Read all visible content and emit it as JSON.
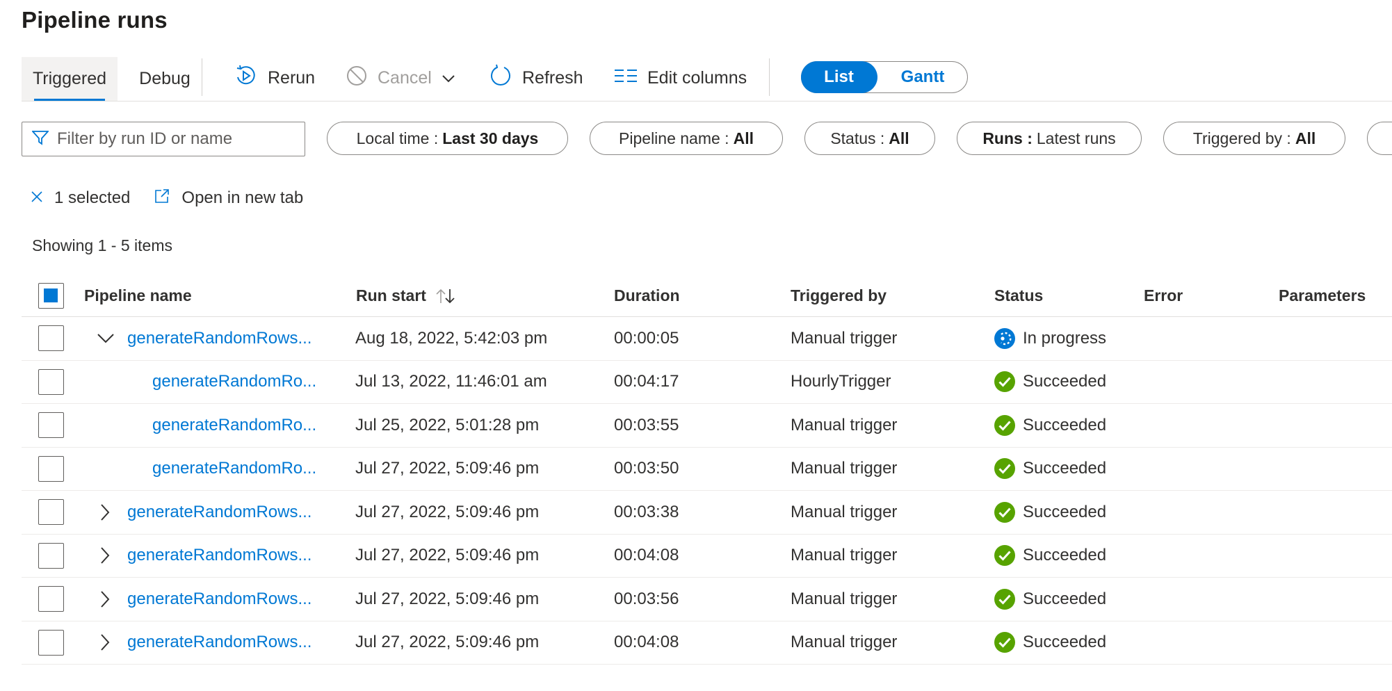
{
  "page": {
    "title": "Pipeline runs"
  },
  "tabs": [
    {
      "label": "Triggered",
      "active": true
    },
    {
      "label": "Debug",
      "active": false
    }
  ],
  "toolbar": {
    "rerun_label": "Rerun",
    "cancel_label": "Cancel",
    "refresh_label": "Refresh",
    "edit_columns_label": "Edit columns",
    "view_toggle": {
      "list_label": "List",
      "gantt_label": "Gantt",
      "selected": "List"
    }
  },
  "filters": {
    "search_placeholder": "Filter by run ID or name",
    "local_time": {
      "key": "Local time :",
      "value": "Last 30 days"
    },
    "pipeline_name": {
      "key": "Pipeline name :",
      "value": "All"
    },
    "status": {
      "key": "Status :",
      "value": "All"
    },
    "runs": {
      "key": "Runs :",
      "value": "Latest runs"
    },
    "triggered_by": {
      "key": "Triggered by :",
      "value": "All"
    }
  },
  "selection": {
    "count_label": "1 selected",
    "open_new_tab_label": "Open in new tab"
  },
  "showing": "Showing 1 - 5 items",
  "table": {
    "columns": {
      "pipeline_name": "Pipeline name",
      "run_start": "Run start",
      "duration": "Duration",
      "triggered_by": "Triggered by",
      "status": "Status",
      "error": "Error",
      "parameters": "Parameters"
    },
    "rows": [
      {
        "name": "generateRandomRows...",
        "run_start": "Aug 18, 2022, 5:42:03 pm",
        "duration": "00:00:05",
        "triggered_by": "Manual trigger",
        "status": "In progress"
      },
      {
        "name": "generateRandomRo...",
        "run_start": "Jul 13, 2022, 11:46:01 am",
        "duration": "00:04:17",
        "triggered_by": "HourlyTrigger",
        "status": "Succeeded"
      },
      {
        "name": "generateRandomRo...",
        "run_start": "Jul 25, 2022, 5:01:28 pm",
        "duration": "00:03:55",
        "triggered_by": "Manual trigger",
        "status": "Succeeded"
      },
      {
        "name": "generateRandomRo...",
        "run_start": "Jul 27, 2022, 5:09:46 pm",
        "duration": "00:03:50",
        "triggered_by": "Manual trigger",
        "status": "Succeeded"
      },
      {
        "name": "generateRandomRows...",
        "run_start": "Jul 27, 2022, 5:09:46 pm",
        "duration": "00:03:38",
        "triggered_by": "Manual trigger",
        "status": "Succeeded"
      },
      {
        "name": "generateRandomRows...",
        "run_start": "Jul 27, 2022, 5:09:46 pm",
        "duration": "00:04:08",
        "triggered_by": "Manual trigger",
        "status": "Succeeded"
      },
      {
        "name": "generateRandomRows...",
        "run_start": "Jul 27, 2022, 5:09:46 pm",
        "duration": "00:03:56",
        "triggered_by": "Manual trigger",
        "status": "Succeeded"
      },
      {
        "name": "generateRandomRows...",
        "run_start": "Jul 27, 2022, 5:09:46 pm",
        "duration": "00:04:08",
        "triggered_by": "Manual trigger",
        "status": "Succeeded"
      }
    ]
  },
  "colors": {
    "accent": "#0078d4",
    "success": "#57a300",
    "border": "#8a8886"
  }
}
